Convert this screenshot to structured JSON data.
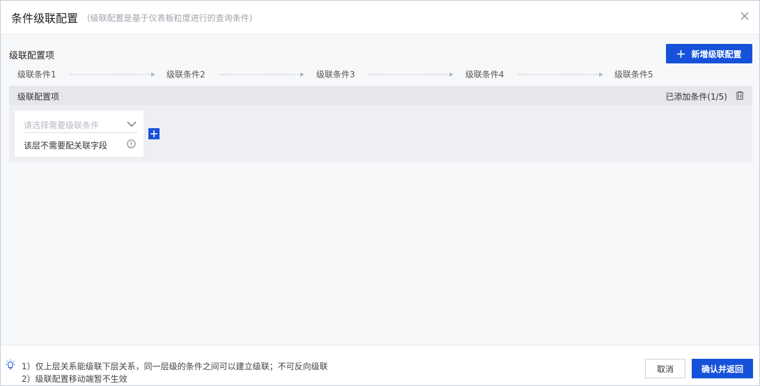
{
  "header": {
    "title": "条件级联配置",
    "subtitle": "(级联配置是基于仪表板粒度进行的查询条件)"
  },
  "section": {
    "title": "级联配置项",
    "add_button_label": "新增级联配置"
  },
  "steps": [
    "级联条件1",
    "级联条件2",
    "级联条件3",
    "级联条件4",
    "级联条件5"
  ],
  "panel": {
    "label": "级联配置项",
    "count": "已添加条件(1/5)",
    "card": {
      "select_placeholder": "请选择需要级联条件",
      "hint": "该层不需要配关联字段"
    }
  },
  "footer": {
    "notes": [
      "1）仅上层关系能级联下层关系，同一层级的条件之间可以建立级联；不可反向级联",
      "2）级联配置移动端暂不生效"
    ],
    "cancel_label": "取消",
    "confirm_label": "确认并返回"
  },
  "colors": {
    "accent": "#1652d9",
    "panel_bg": "#eeeff2",
    "page_bg": "#f7f8fa"
  },
  "icons": [
    "close-icon",
    "plus-icon",
    "trash-icon",
    "chevron-down-icon",
    "info-icon",
    "lightbulb-icon",
    "arrow-right-icon"
  ]
}
